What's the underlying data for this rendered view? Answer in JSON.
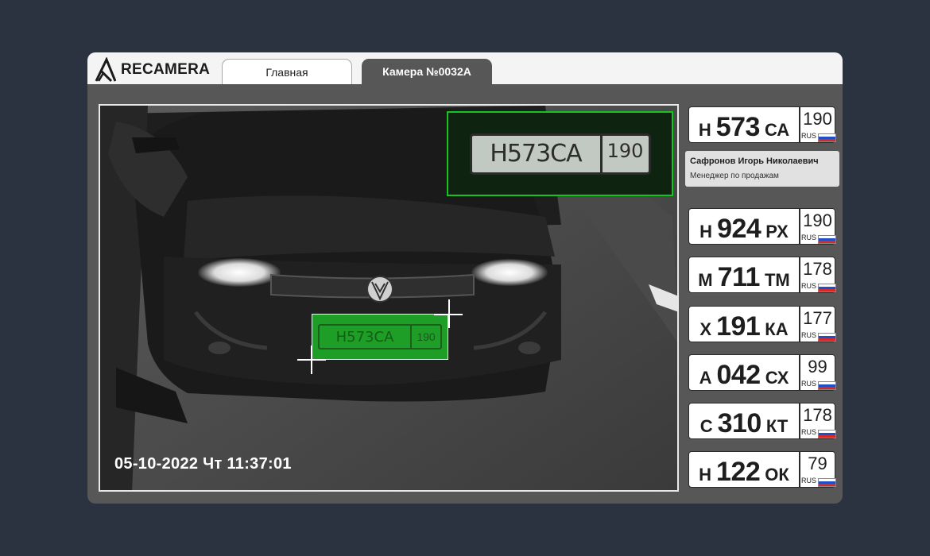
{
  "app": {
    "brand": "RECAMERA"
  },
  "tabs": [
    {
      "label": "Главная",
      "active": false
    },
    {
      "label": "Камера №0032А",
      "active": true
    }
  ],
  "camera": {
    "timestamp": "05-10-2022 Чт 11:37:01",
    "detected_plate": {
      "number": "Н573СА",
      "region": "190"
    },
    "zoom_plate": {
      "number": "Н573СА",
      "region": "190"
    }
  },
  "current_plate": {
    "letter1": "Н",
    "digits": "573",
    "letters2": "СА",
    "region": "190",
    "country": "RUS"
  },
  "owner": {
    "name": "Сафронов Игорь Николаевич",
    "role": "Менеджер по продажам"
  },
  "plates": [
    {
      "letter1": "Н",
      "digits": "924",
      "letters2": "РХ",
      "region": "190",
      "country": "RUS"
    },
    {
      "letter1": "М",
      "digits": "711",
      "letters2": "ТМ",
      "region": "178",
      "country": "RUS"
    },
    {
      "letter1": "Х",
      "digits": "191",
      "letters2": "КА",
      "region": "177",
      "country": "RUS"
    },
    {
      "letter1": "А",
      "digits": "042",
      "letters2": "СХ",
      "region": "99",
      "country": "RUS"
    },
    {
      "letter1": "С",
      "digits": "310",
      "letters2": "КТ",
      "region": "178",
      "country": "RUS"
    },
    {
      "letter1": "Н",
      "digits": "122",
      "letters2": "ОК",
      "region": "79",
      "country": "RUS"
    }
  ],
  "colors": {
    "background": "#2b3240",
    "panel": "#575757",
    "detect_green": "#16c41f"
  }
}
